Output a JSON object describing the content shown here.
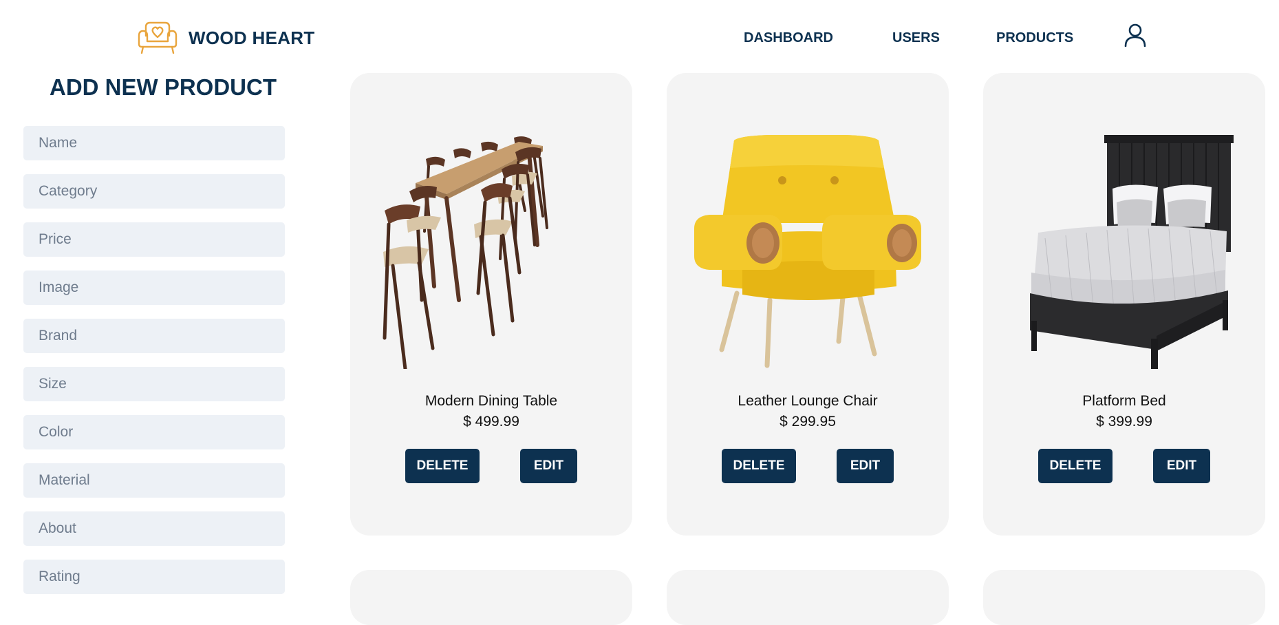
{
  "brand": {
    "name": "WOOD HEART",
    "accent_color": "#e9a53d",
    "primary_color": "#0d3150"
  },
  "nav": {
    "dashboard": "DASHBOARD",
    "users": "USERS",
    "products": "PRODUCTS",
    "user_icon": "user-icon"
  },
  "form": {
    "title": "ADD NEW PRODUCT",
    "fields": {
      "name": "Name",
      "category": "Category",
      "price": "Price",
      "image": "Image",
      "brand": "Brand",
      "size": "Size",
      "color": "Color",
      "material": "Material",
      "about": "About",
      "rating": "Rating"
    }
  },
  "products": [
    {
      "name": "Modern Dining Table",
      "price": "$ 499.99",
      "image": "dining-table-with-chairs",
      "delete_label": "DELETE",
      "edit_label": "EDIT"
    },
    {
      "name": "Leather Lounge Chair",
      "price": "$ 299.95",
      "image": "yellow-lounge-chair",
      "delete_label": "DELETE",
      "edit_label": "EDIT"
    },
    {
      "name": "Platform Bed",
      "price": "$ 399.99",
      "image": "black-platform-bed",
      "delete_label": "DELETE",
      "edit_label": "EDIT"
    }
  ]
}
